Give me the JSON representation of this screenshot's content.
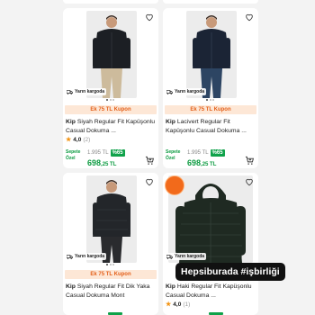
{
  "products": [
    {
      "brand": "Kip",
      "name": "Siyah Regular Fit Kapüşonlu Casual Dokuma ...",
      "shipping": "Yarın kargoda",
      "coupon": "Ek 75 TL Kupon",
      "rating": "4,0",
      "review_count": "(2)",
      "basket_label_1": "Sepete",
      "basket_label_2": "Özel",
      "old_price": "1.995 TL",
      "discount": "%65",
      "new_price_main": "698",
      "new_price_cents": ",25 TL",
      "jacket_color": "#1c1f24",
      "pants_color": "#cdbb9c"
    },
    {
      "brand": "Kip",
      "name": "Lacivert Regular Fit Kapüşonlu Casual Dokuma ...",
      "shipping": "Yarın kargoda",
      "coupon": "Ek 75 TL Kupon",
      "basket_label_1": "Sepete",
      "basket_label_2": "Özel",
      "old_price": "1.995 TL",
      "discount": "%65",
      "new_price_main": "698",
      "new_price_cents": ",25 TL",
      "jacket_color": "#1b2435",
      "pants_color": "#2d4563"
    },
    {
      "brand": "Kip",
      "name": "Siyah Regular Fit Dik Yaka Casual Dokuma Mont",
      "shipping": "Yarın kargoda",
      "coupon": "Ek 75 TL Kupon",
      "jacket_color": "#23262a",
      "pants_color": "#2a2b2e"
    },
    {
      "brand": "Kip",
      "name": "Haki Regular Fit Kapüşonlu Casual Dokuma ...",
      "shipping": "Yarın kargoda",
      "promo_badge": "",
      "rating": "4,0",
      "review_count": "(1)",
      "jacket_color": "#1f2a22",
      "pants_color": "#1f2a22"
    }
  ],
  "watermark": "Hepsiburada #işbirliği",
  "colors": {
    "accent_orange": "#e4601a",
    "price_green": "#0a9a3f",
    "star": "#f29312"
  }
}
